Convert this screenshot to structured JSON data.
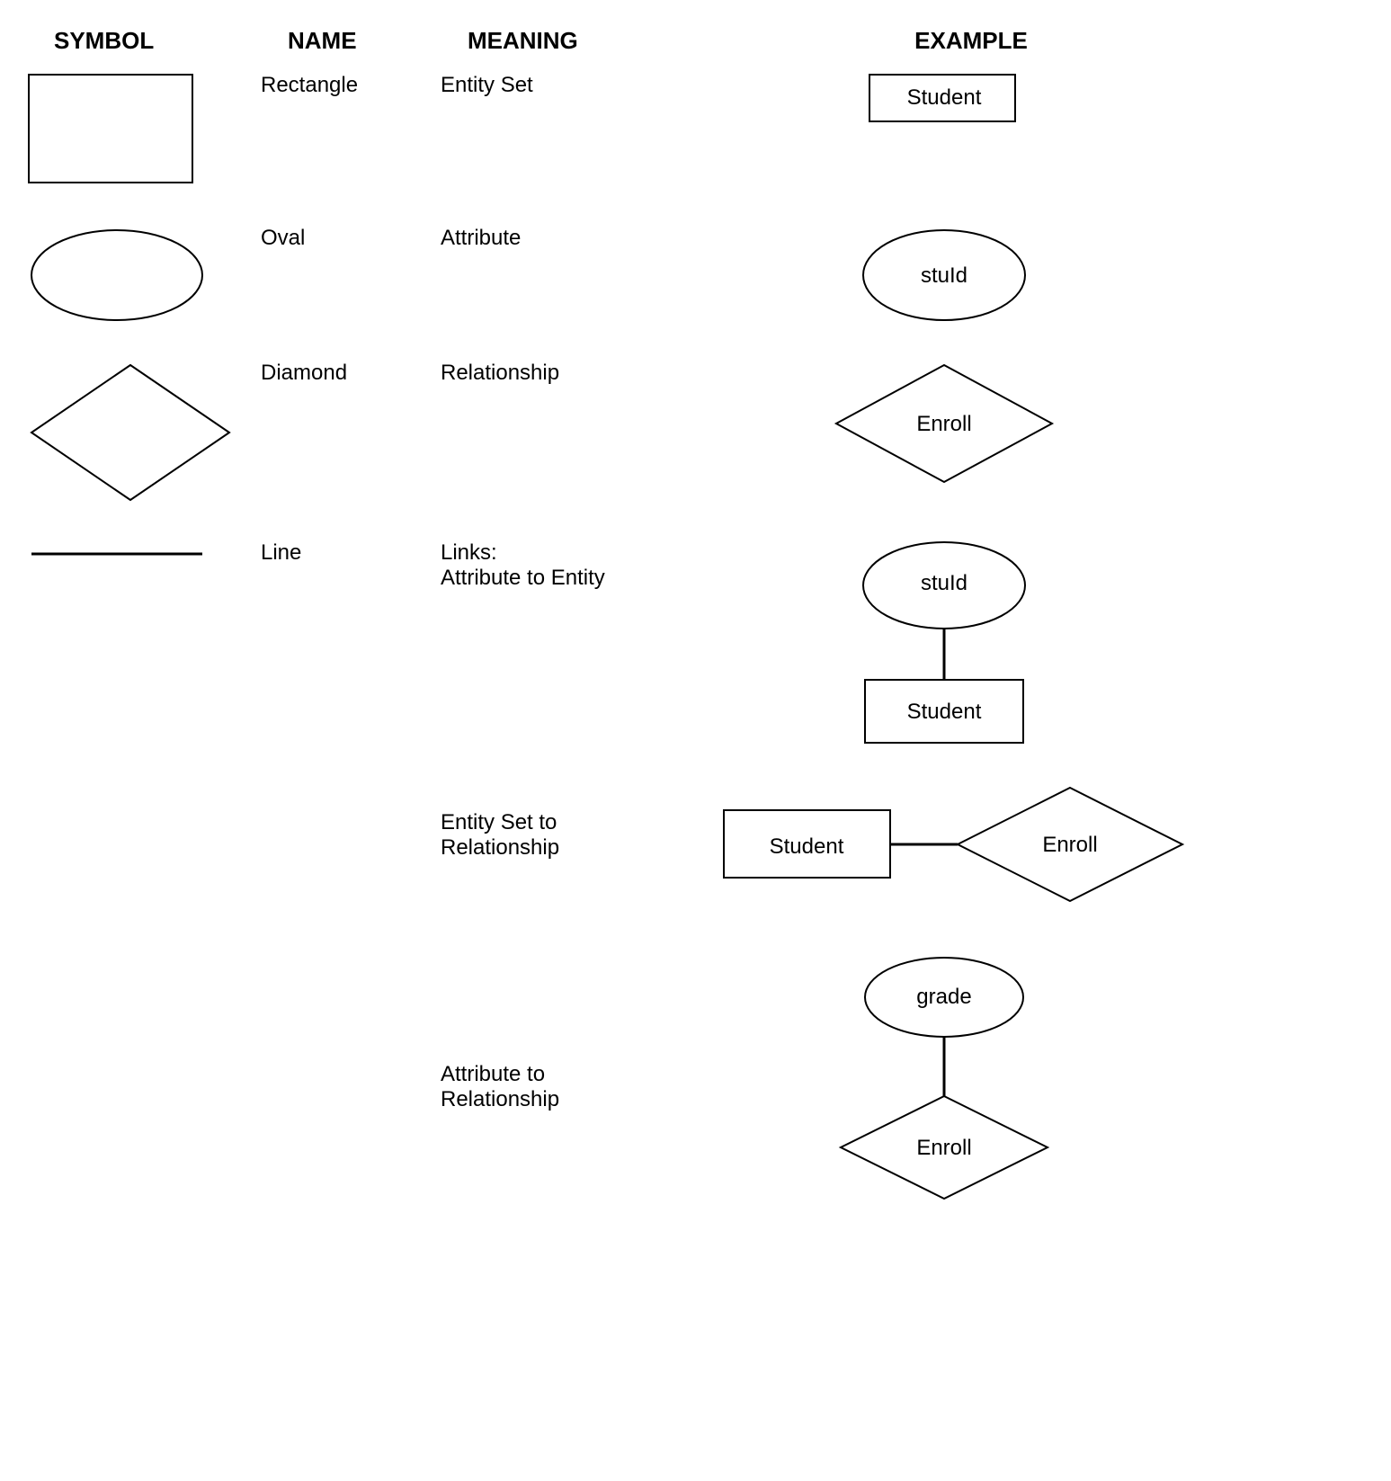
{
  "headers": {
    "symbol": "SYMBOL",
    "name": "NAME",
    "meaning": "MEANING",
    "example": "EXAMPLE"
  },
  "rows": [
    {
      "name": "Rectangle",
      "meaning": "Entity Set",
      "example_label": "Student",
      "shape": "rectangle"
    },
    {
      "name": "Oval",
      "meaning": "Attribute",
      "example_label": "stuId",
      "shape": "oval"
    },
    {
      "name": "Diamond",
      "meaning": "Relationship",
      "example_label": "Enroll",
      "shape": "diamond"
    },
    {
      "name": "Line",
      "meaning": "Links:\nAttribute to Entity",
      "example_top": "stuId",
      "example_bottom": "Student",
      "shape": "line"
    },
    {
      "meaning": "Entity Set to\nRelationship",
      "example_left": "Student",
      "example_right": "Enroll"
    },
    {
      "meaning": "Attribute to\nRelationship",
      "example_top": "grade",
      "example_bottom": "Enroll"
    }
  ]
}
